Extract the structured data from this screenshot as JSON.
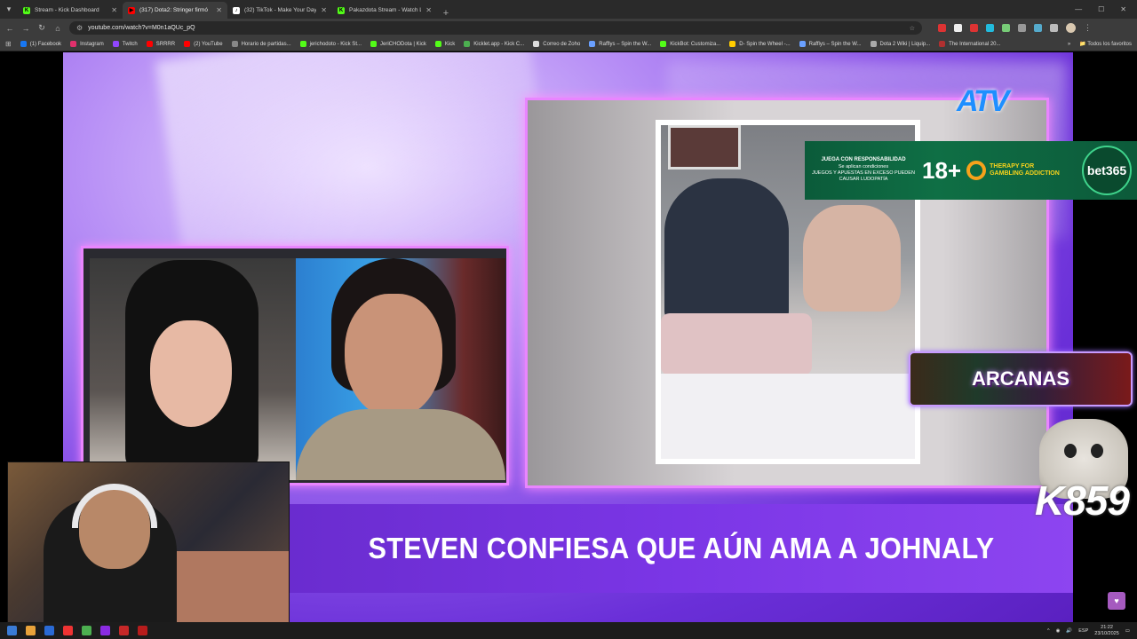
{
  "browser": {
    "tabs": [
      {
        "title": "Stream - Kick Dashboard",
        "fav_color": "#53fc18",
        "fav_glyph": "K",
        "active": false
      },
      {
        "title": "(317) Dota2: Stringer firmó",
        "fav_color": "#ff0000",
        "fav_glyph": "▶",
        "active": true
      },
      {
        "title": "(32) TikTok - Make Your Day",
        "fav_color": "#ffffff",
        "fav_glyph": "♪",
        "active": false
      },
      {
        "title": "Pakazdota Stream - Watch Live",
        "fav_color": "#53fc18",
        "fav_glyph": "K",
        "active": false
      }
    ],
    "close_glyph": "✕",
    "new_tab_glyph": "+",
    "url": "youtube.com/watch?v=M0n1aQUc_pQ",
    "bookmarks": [
      {
        "label": "(1) Facebook",
        "color": "#1877f2"
      },
      {
        "label": "Instagram",
        "color": "#e1306c"
      },
      {
        "label": "Twitch",
        "color": "#9146ff"
      },
      {
        "label": "SRRRR",
        "color": "#ff0000"
      },
      {
        "label": "(2) YouTube",
        "color": "#ff0000"
      },
      {
        "label": "Horario de partidas...",
        "color": "#888888"
      },
      {
        "label": "jerichodoto - Kick St...",
        "color": "#53fc18"
      },
      {
        "label": "JeriCHODota | Kick",
        "color": "#53fc18"
      },
      {
        "label": "Kick",
        "color": "#53fc18"
      },
      {
        "label": "Kicklet.app - Kick C...",
        "color": "#4caf50"
      },
      {
        "label": "Correo de Zoho",
        "color": "#dddddd"
      },
      {
        "label": "Rafflys – Spin the W...",
        "color": "#6aa0ff"
      },
      {
        "label": "KickBot: Customiza...",
        "color": "#53fc18"
      },
      {
        "label": "D- Spin the Wheel -...",
        "color": "#ffcc00"
      },
      {
        "label": "Rafflys – Spin the W...",
        "color": "#6aa0ff"
      },
      {
        "label": "Dota 2 Wiki | Liquip...",
        "color": "#aaaaaa"
      },
      {
        "label": "The International 20...",
        "color": "#b03030"
      }
    ],
    "bookmarks_more": "»",
    "all_bookmarks": "Todos los favoritos"
  },
  "video": {
    "channel_logo": "ATV",
    "headline": "STEVEN CONFIESA QUE AÚN AMA A JOHNALY",
    "ad": {
      "responsibility": "JUEGA CON RESPONSABILIDAD",
      "conditions": "Se aplican condiciones",
      "warning": "JUEGOS Y APUESTAS EN EXCESO PUEDEN CAUSAR LUDOPATÍA",
      "age": "18+",
      "therapy": "THERAPY FOR GAMBLING ADDICTION",
      "brand": "bet365"
    },
    "overlay_arcanas": "ARCANAS",
    "overlay_counter": "K859"
  },
  "taskbar": {
    "lang": "ESP",
    "time": "21:22",
    "date": "23/10/2025"
  }
}
